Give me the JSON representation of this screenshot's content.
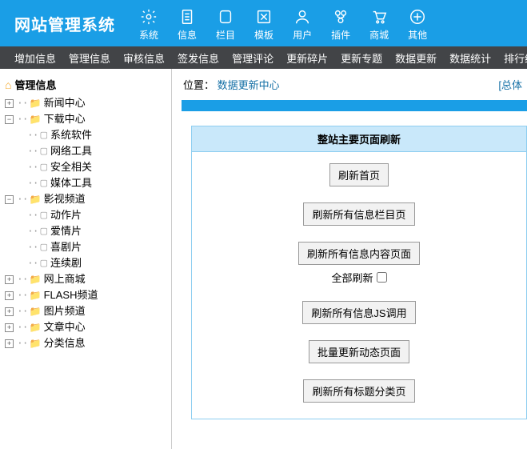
{
  "header": {
    "logo": "网站管理系统",
    "nav": [
      {
        "label": "系统",
        "icon": "gear"
      },
      {
        "label": "信息",
        "icon": "clipboard"
      },
      {
        "label": "栏目",
        "icon": "column"
      },
      {
        "label": "模板",
        "icon": "template"
      },
      {
        "label": "用户",
        "icon": "user"
      },
      {
        "label": "插件",
        "icon": "plugin"
      },
      {
        "label": "商城",
        "icon": "cart"
      },
      {
        "label": "其他",
        "icon": "plus"
      }
    ]
  },
  "subnav": [
    "增加信息",
    "管理信息",
    "审核信息",
    "签发信息",
    "管理评论",
    "更新碎片",
    "更新专题",
    "数据更新",
    "数据统计",
    "排行统"
  ],
  "tree": {
    "root": "管理信息",
    "nodes": [
      {
        "label": "新闻中心",
        "expanded": false
      },
      {
        "label": "下载中心",
        "expanded": true,
        "children": [
          "系统软件",
          "网络工具",
          "安全相关",
          "媒体工具"
        ]
      },
      {
        "label": "影视频道",
        "expanded": true,
        "children": [
          "动作片",
          "爱情片",
          "喜剧片",
          "连续剧"
        ]
      },
      {
        "label": "网上商城",
        "expanded": false
      },
      {
        "label": "FLASH频道",
        "expanded": false
      },
      {
        "label": "图片频道",
        "expanded": false
      },
      {
        "label": "文章中心",
        "expanded": false
      },
      {
        "label": "分类信息",
        "expanded": false
      }
    ]
  },
  "breadcrumb": {
    "prefix": "位置：",
    "link": "数据更新中心",
    "right": "[总体"
  },
  "panel": {
    "title": "整站主要页面刷新",
    "buttons": [
      "刷新首页",
      "刷新所有信息栏目页",
      "刷新所有信息内容页面",
      "刷新所有信息JS调用",
      "批量更新动态页面",
      "刷新所有标题分类页"
    ],
    "checkbox_label": "全部刷新"
  }
}
